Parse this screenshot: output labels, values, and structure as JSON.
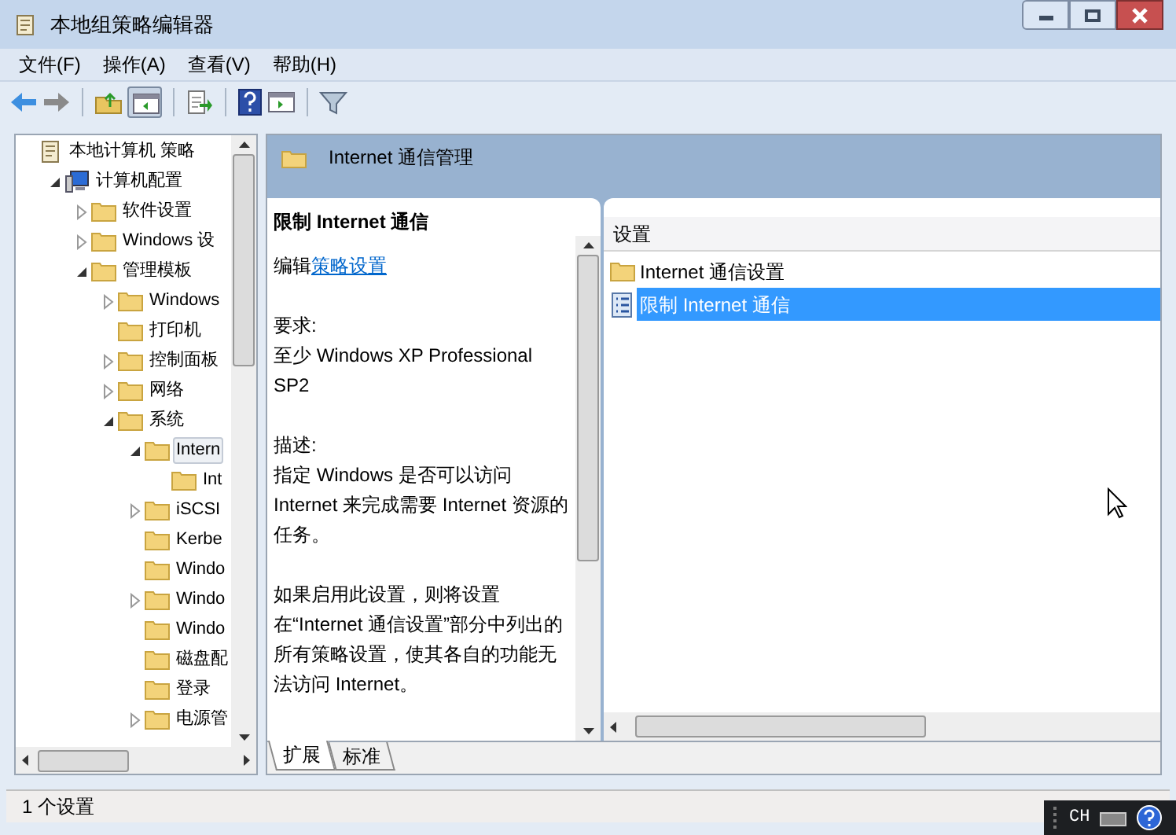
{
  "window": {
    "title": "本地组策略编辑器"
  },
  "menu": [
    "文件(F)",
    "操作(A)",
    "查看(V)",
    "帮助(H)"
  ],
  "tree": [
    {
      "label": "本地计算机 策略",
      "kind": "policy",
      "selected": false,
      "children": [
        {
          "label": "计算机配置",
          "kind": "computer",
          "expanded": true,
          "selected": false,
          "children": [
            {
              "label": "软件设置",
              "expanded": false,
              "selected": false
            },
            {
              "label": "Windows 设",
              "expanded": false,
              "selected": false
            },
            {
              "label": "管理模板",
              "expanded": true,
              "selected": false,
              "children": [
                {
                  "label": "Windows",
                  "expanded": false,
                  "selected": false
                },
                {
                  "label": "打印机",
                  "selected": false
                },
                {
                  "label": "控制面板",
                  "expanded": false,
                  "selected": false
                },
                {
                  "label": "网络",
                  "expanded": false,
                  "selected": false
                },
                {
                  "label": "系统",
                  "expanded": true,
                  "selected": false,
                  "children": [
                    {
                      "label": "Intern",
                      "expanded": true,
                      "selected": true,
                      "children": [
                        {
                          "label": "Int",
                          "selected": false
                        }
                      ]
                    },
                    {
                      "label": "iSCSI",
                      "expanded": false,
                      "selected": false
                    },
                    {
                      "label": "Kerbe",
                      "selected": false
                    },
                    {
                      "label": "Windo",
                      "selected": false
                    },
                    {
                      "label": "Windo",
                      "expanded": false,
                      "selected": false
                    },
                    {
                      "label": "Windo",
                      "selected": false
                    },
                    {
                      "label": "磁盘配",
                      "selected": false
                    },
                    {
                      "label": "登录",
                      "selected": false
                    },
                    {
                      "label": "电源管",
                      "expanded": false,
                      "selected": false
                    }
                  ]
                }
              ]
            }
          ]
        }
      ]
    }
  ],
  "header": {
    "title": "Internet 通信管理"
  },
  "description": {
    "title": "限制 Internet 通信",
    "edit_prefix": "编辑",
    "edit_link": "策略设置",
    "paragraphs": [
      [
        "要求:",
        "至少 Windows XP Professional SP2"
      ],
      [
        "描述:",
        "指定 Windows 是否可以访问 Internet 来完成需要 Internet 资源的任务。"
      ],
      [
        "如果启用此设置，则将设置在“Internet 通信设置”部分中列出的所有策略设置，使其各自的功能无法访问 Internet。"
      ]
    ]
  },
  "list": {
    "column": "设置",
    "rows": [
      {
        "label": "Internet 通信设置",
        "kind": "folder",
        "selected": false
      },
      {
        "label": "限制 Internet 通信",
        "kind": "setting",
        "selected": true
      }
    ]
  },
  "tabs": [
    {
      "label": "扩展",
      "selected": true
    },
    {
      "label": "标准",
      "selected": false
    }
  ],
  "status_bar": "1 个设置",
  "language_bar": "CH"
}
